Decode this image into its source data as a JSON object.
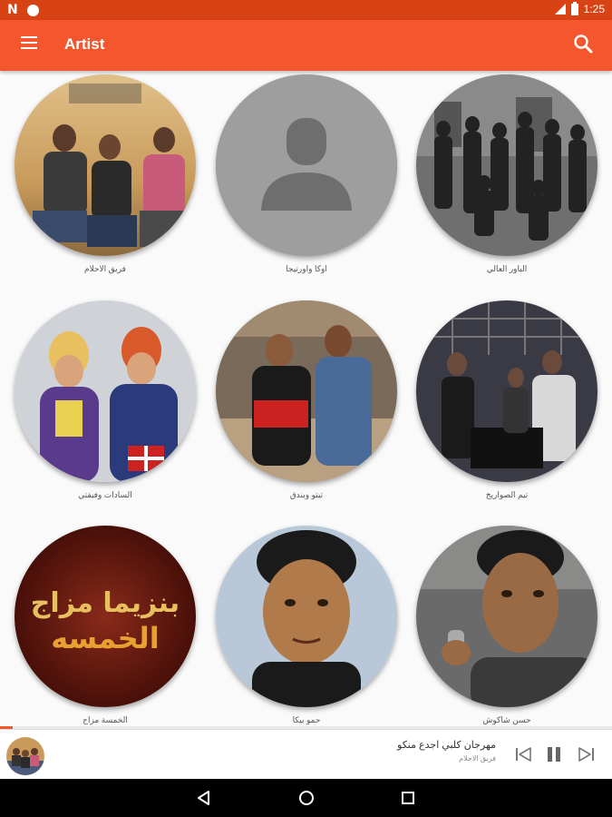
{
  "status_bar": {
    "time": "1:25",
    "left_icons": [
      "n-notification-icon",
      "circle-notification-icon"
    ],
    "right_icons": [
      "signal-icon",
      "battery-icon"
    ]
  },
  "app_bar": {
    "title": "Artist",
    "menu_icon": "menu-icon",
    "search_icon": "search-icon",
    "color": "#f4572d"
  },
  "artists": [
    {
      "name": "فريق الاحلام",
      "icon": "artist-photo"
    },
    {
      "name": "اوكا واورتيجا",
      "icon": "default-person-icon"
    },
    {
      "name": "الباور العالي",
      "icon": "artist-photo"
    },
    {
      "name": "السادات وفيفتي",
      "icon": "artist-photo"
    },
    {
      "name": "تيتو وبندق",
      "icon": "artist-photo"
    },
    {
      "name": "تيم الصواريخ",
      "icon": "artist-photo"
    },
    {
      "name": "الخمسة مزاج",
      "icon": "artist-photo",
      "logo_text": "بنزيما مزاج الخمسة"
    },
    {
      "name": "حمو بيكا",
      "icon": "artist-photo"
    },
    {
      "name": "حسن شاكوش",
      "icon": "artist-photo"
    }
  ],
  "now_playing": {
    "title": "مهرجان كلبي اجدع منكو",
    "artist": "فريق الاحلام",
    "progress": 0.02,
    "controls": [
      "skip-previous-icon",
      "pause-icon",
      "skip-next-icon"
    ]
  },
  "nav_bar": {
    "buttons": [
      "back-icon",
      "home-icon",
      "recents-icon"
    ]
  }
}
